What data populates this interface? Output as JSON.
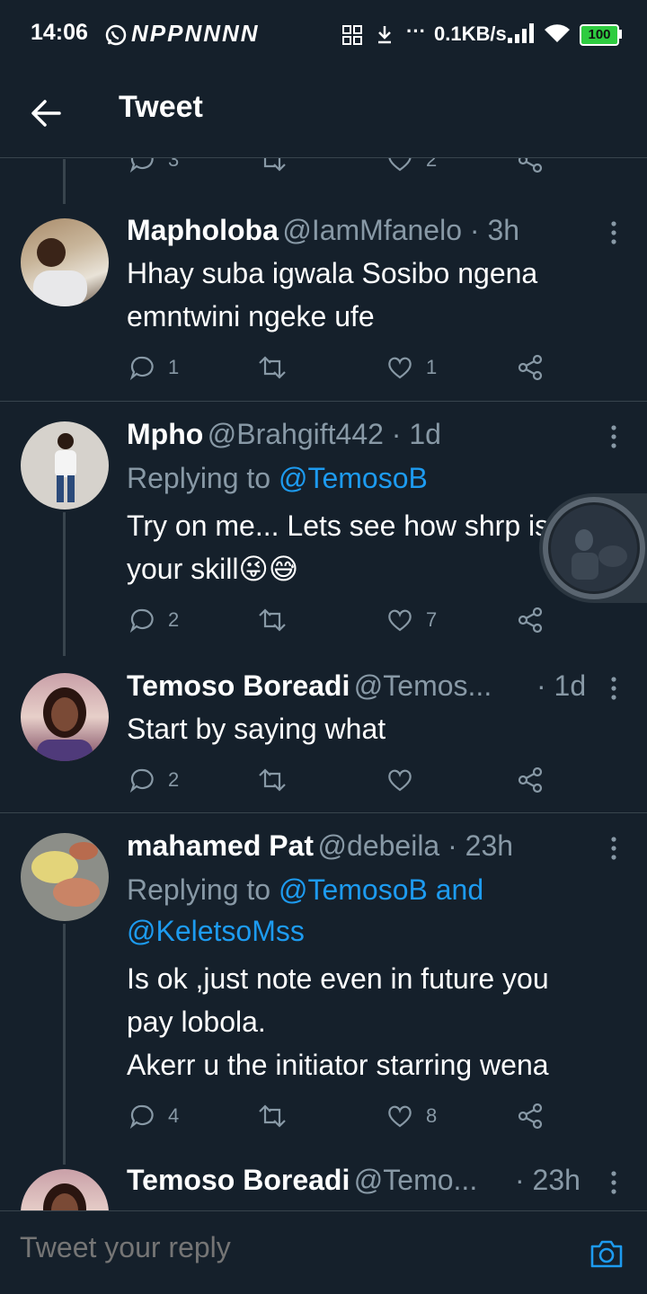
{
  "status_bar": {
    "time": "14:06",
    "app_letters": "NPPNNNN",
    "network_speed": "0.1KB/s",
    "battery": "100",
    "ellipsis": "···"
  },
  "header": {
    "title": "Tweet"
  },
  "top_partial": {
    "replies": "3",
    "likes": "2"
  },
  "tweets": [
    {
      "name": "Mapholoba",
      "meta": "@IamMfanelo · 3h",
      "body": [
        "Hhay suba igwala Sosibo ngena",
        "emntwini ngeke ufe"
      ],
      "replies": "1",
      "retweets": "",
      "likes": "1"
    },
    {
      "name": "Mpho",
      "meta": "@Brahgift442 · 1d",
      "replying_prefix": "Replying to ",
      "replying_to": "@TemosoB",
      "body": [
        "Try on me... Lets see how shrp is",
        "your skill😜😅"
      ],
      "replies": "2",
      "retweets": "",
      "likes": "7"
    },
    {
      "name": "Temoso Boreadi",
      "meta": "@Temos...",
      "time": "· 1d",
      "body": [
        "Start by saying what"
      ],
      "replies": "2",
      "retweets": "",
      "likes": ""
    },
    {
      "name": "mahamed Pat",
      "meta": "@debeila · 23h",
      "replying_prefix": "Replying to ",
      "replying_to": "@TemosoB and",
      "replying_to_2": "@KeletsoMss",
      "body": [
        "Is ok ,just note even in future you",
        "pay lobola.",
        "Akerr u the initiator starring wena"
      ],
      "replies": "4",
      "retweets": "",
      "likes": "8"
    },
    {
      "name": "Temoso Boreadi",
      "meta": "@Temo...",
      "time": "· 23h"
    }
  ],
  "composer": {
    "placeholder": "Tweet your reply"
  },
  "colors": {
    "background": "#15202b",
    "accent": "#1d9bf0",
    "muted": "#8899a6",
    "divider": "#38444d"
  },
  "icons": [
    "back-arrow-icon",
    "reply-icon",
    "retweet-icon",
    "like-icon",
    "share-icon",
    "more-icon",
    "camera-icon"
  ]
}
